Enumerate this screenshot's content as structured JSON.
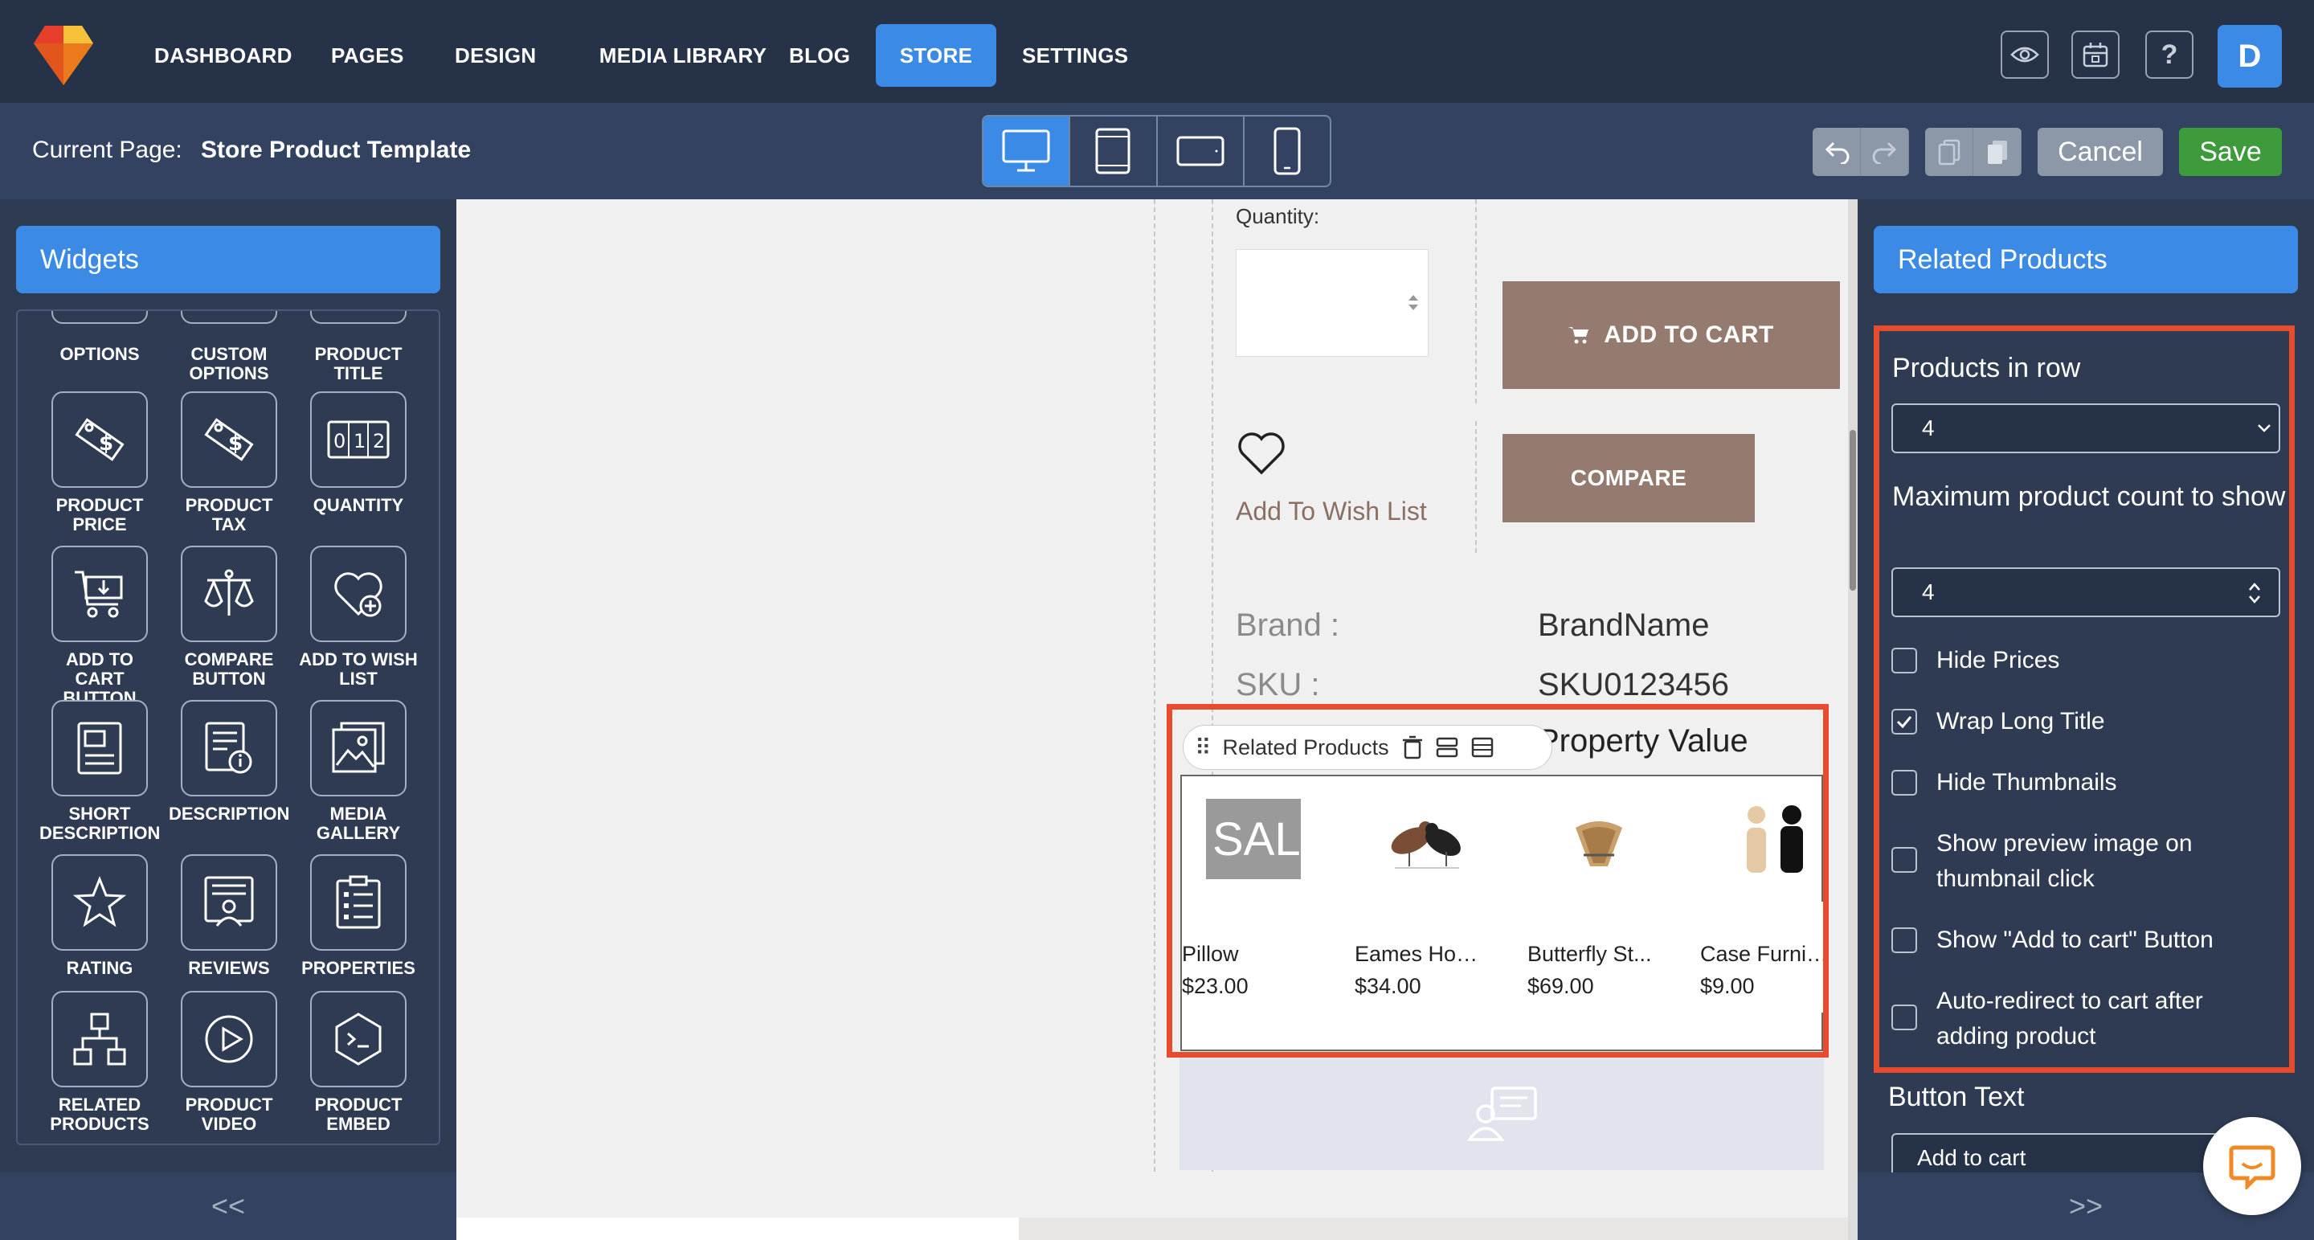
{
  "nav": {
    "items": [
      "DASHBOARD",
      "PAGES",
      "DESIGN",
      "MEDIA LIBRARY",
      "BLOG",
      "STORE",
      "SETTINGS"
    ],
    "active": "STORE",
    "avatar_letter": "D"
  },
  "subbar": {
    "current_label": "Current Page:",
    "current_value": "Store Product Template",
    "cancel_label": "Cancel",
    "save_label": "Save"
  },
  "widgets": {
    "header": "Widgets",
    "partial_labels": [
      "OPTIONS",
      "CUSTOM OPTIONS",
      "PRODUCT TITLE"
    ],
    "items": [
      {
        "label": "PRODUCT PRICE",
        "icon": "price-tag-icon"
      },
      {
        "label": "PRODUCT TAX",
        "icon": "tax-tag-icon"
      },
      {
        "label": "QUANTITY",
        "icon": "counter-icon"
      },
      {
        "label": "ADD TO CART BUTTON",
        "icon": "cart-icon"
      },
      {
        "label": "COMPARE BUTTON",
        "icon": "scale-icon"
      },
      {
        "label": "ADD TO WISH LIST",
        "icon": "heart-plus-icon"
      },
      {
        "label": "SHORT DESCRIPTION",
        "icon": "short-doc-icon"
      },
      {
        "label": "DESCRIPTION",
        "icon": "doc-info-icon"
      },
      {
        "label": "MEDIA GALLERY",
        "icon": "gallery-icon"
      },
      {
        "label": "RATING",
        "icon": "star-icon"
      },
      {
        "label": "REVIEWS",
        "icon": "reviews-icon"
      },
      {
        "label": "PROPERTIES",
        "icon": "clipboard-list-icon"
      },
      {
        "label": "RELATED PRODUCTS",
        "icon": "hierarchy-icon"
      },
      {
        "label": "PRODUCT VIDEO",
        "icon": "play-icon"
      },
      {
        "label": "PRODUCT EMBED",
        "icon": "terminal-icon"
      }
    ],
    "collapse_label": "<<"
  },
  "canvas": {
    "quantity_label": "Quantity:",
    "add_to_cart": "ADD TO CART",
    "compare": "COMPARE",
    "wish_list": "Add To Wish List",
    "brand_label": "Brand :",
    "brand_value": "BrandName",
    "sku_label": "SKU :",
    "sku_value": "SKU0123456",
    "property_value": "Property Value",
    "related_toolbar_label": "Related Products",
    "related_products": [
      {
        "name": "Pillow",
        "price": "$23.00",
        "thumb_text": "SAL"
      },
      {
        "name": "Eames Hou...",
        "price": "$34.00"
      },
      {
        "name": "Butterfly St...",
        "price": "$69.00"
      },
      {
        "name": "Case Furnit...",
        "price": "$9.00"
      }
    ]
  },
  "settings": {
    "header": "Related Products",
    "products_in_row_label": "Products in row",
    "products_in_row_value": "4",
    "max_count_label": "Maximum product count to show",
    "max_count_value": "4",
    "checkboxes": [
      {
        "label": "Hide Prices",
        "checked": false
      },
      {
        "label": "Wrap Long Title",
        "checked": true
      },
      {
        "label": "Hide Thumbnails",
        "checked": false
      },
      {
        "label": "Show preview image on thumbnail click",
        "checked": false
      },
      {
        "label": "Show \"Add to cart\" Button",
        "checked": false
      },
      {
        "label": "Auto-redirect to cart after adding product",
        "checked": false
      }
    ],
    "button_text_label": "Button Text",
    "button_text_value": "Add to cart",
    "expand_label": ">>"
  },
  "colors": {
    "accent": "#3b8ae6",
    "highlight": "#e84c2f",
    "save": "#3e9b3b",
    "product_button": "#957b6f"
  }
}
